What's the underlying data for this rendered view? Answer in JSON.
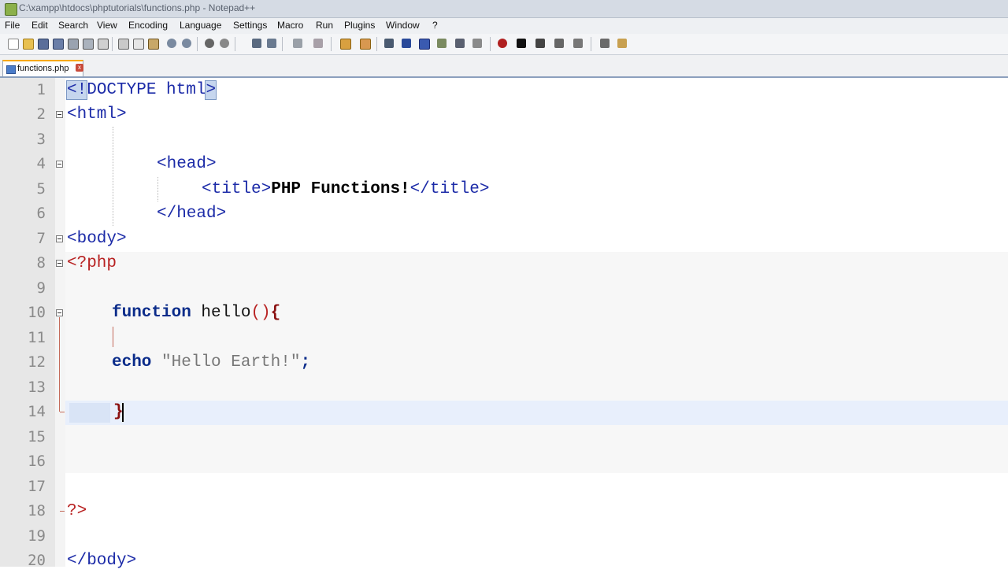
{
  "window": {
    "title": "C:\\xampp\\htdocs\\phptutorials\\functions.php - Notepad++"
  },
  "menu": [
    "File",
    "Edit",
    "Search",
    "View",
    "Encoding",
    "Language",
    "Settings",
    "Macro",
    "Run",
    "Plugins",
    "Window",
    "?"
  ],
  "toolbar": {
    "buttons": [
      "new-file-icon",
      "open-file-icon",
      "save-icon",
      "save-all-icon",
      "close-icon",
      "close-all-icon",
      "print-icon",
      "cut-icon",
      "copy-icon",
      "paste-icon",
      "undo-icon",
      "redo-icon",
      "find-icon",
      "replace-icon",
      "zoom-in-icon",
      "zoom-out-icon",
      "sync-v-icon",
      "sync-h-icon",
      "word-wrap-icon",
      "all-chars-icon",
      "indent-guide-icon",
      "udl-icon",
      "doc-map-icon",
      "function-list-icon",
      "record-macro-icon",
      "stop-record-icon",
      "play-macro-icon",
      "run-macro-multiple-icon",
      "save-macro-icon",
      "monitoring-icon",
      "panel-icon"
    ]
  },
  "tab": {
    "label": "functions.php",
    "close": "x"
  },
  "editor": {
    "line_numbers": [
      "1",
      "2",
      "3",
      "4",
      "5",
      "6",
      "7",
      "8",
      "9",
      "10",
      "11",
      "12",
      "13",
      "14",
      "15",
      "16",
      "17",
      "18",
      "19",
      "20"
    ],
    "lines": {
      "l1": {
        "open": "<!",
        "rest": "DOCTYPE html",
        "close": ">"
      },
      "l2": "<html>",
      "l4": "<head>",
      "l5_open": "<title>",
      "l5_text": "PHP Functions!",
      "l5_close": "</title>",
      "l6": "</head>",
      "l7": "<body>",
      "l8": "<?php",
      "l10_kw": "function",
      "l10_name": " hello",
      "l10_paren": "()",
      "l10_brace": "{",
      "l12_kw": "echo",
      "l12_str": " \"Hello Earth!\"",
      "l12_semi": ";",
      "l14": "}",
      "l18": "?>",
      "l20": "</body>"
    }
  },
  "colors": {
    "tag": "#1c2ba8",
    "php": "#b82222",
    "keyword": "#0b2c8a",
    "current_line": "#e8effc"
  }
}
